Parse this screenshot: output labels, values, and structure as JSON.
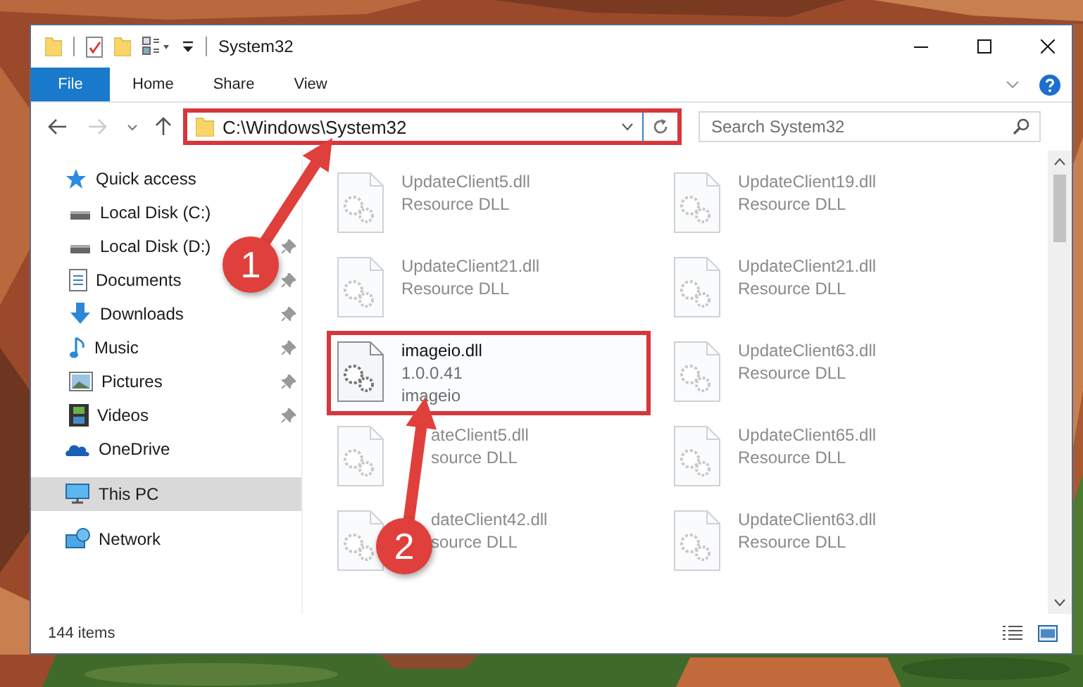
{
  "window": {
    "title": "System32"
  },
  "ribbon": {
    "tabs": [
      {
        "label": "File",
        "kind": "file",
        "selected": false
      },
      {
        "label": "Home",
        "kind": "tab",
        "selected": false
      },
      {
        "label": "Share",
        "kind": "tab",
        "selected": false
      },
      {
        "label": "View",
        "kind": "tab",
        "selected": false
      }
    ]
  },
  "address_bar": {
    "path": "C:\\Windows\\System32",
    "highlighted": true
  },
  "search": {
    "placeholder": "Search System32"
  },
  "nav": {
    "items": [
      {
        "label": "Quick access",
        "kind": "star",
        "selected": false,
        "children": [
          {
            "label": "Local Disk (C:)",
            "kind": "drive",
            "selected": false,
            "pinned": false
          },
          {
            "label": "Local Disk (D:)",
            "kind": "drive",
            "selected": false,
            "pinned": true
          },
          {
            "label": "Documents",
            "kind": "document",
            "selected": false,
            "pinned": true
          },
          {
            "label": "Downloads",
            "kind": "download",
            "selected": false,
            "pinned": true
          },
          {
            "label": "Music",
            "kind": "music",
            "selected": false,
            "pinned": true
          },
          {
            "label": "Pictures",
            "kind": "picture",
            "selected": false,
            "pinned": true
          },
          {
            "label": "Videos",
            "kind": "video",
            "selected": false,
            "pinned": true
          }
        ]
      },
      {
        "label": "OneDrive",
        "kind": "cloud",
        "selected": false
      },
      {
        "label": "This PC",
        "kind": "computer",
        "selected": true
      },
      {
        "label": "Network",
        "kind": "network",
        "selected": false
      }
    ]
  },
  "files": [
    {
      "name": "UpdateClient5.dll",
      "details": [
        "Resource DLL"
      ],
      "faded": true,
      "highlighted": false
    },
    {
      "name": "UpdateClient19.dll",
      "details": [
        "Resource DLL"
      ],
      "faded": true,
      "highlighted": false
    },
    {
      "name": "UpdateClient21.dll",
      "details": [
        "Resource DLL"
      ],
      "faded": true,
      "highlighted": false
    },
    {
      "name": "UpdateClient21.dll",
      "details": [
        "Resource DLL"
      ],
      "faded": true,
      "highlighted": false
    },
    {
      "name": "imageio.dll",
      "details": [
        "1.0.0.41",
        "imageio"
      ],
      "faded": false,
      "highlighted": true
    },
    {
      "name": "UpdateClient63.dll",
      "details": [
        "Resource DLL"
      ],
      "faded": true,
      "highlighted": false
    },
    {
      "name": "ateClient5.dll",
      "details": [
        "source DLL"
      ],
      "faded": true,
      "highlighted": false,
      "partly_covered": true
    },
    {
      "name": "UpdateClient65.dll",
      "details": [
        "Resource DLL"
      ],
      "faded": true,
      "highlighted": false
    },
    {
      "name": "dateClient42.dll",
      "details": [
        "source DLL"
      ],
      "faded": true,
      "highlighted": false,
      "partly_covered": true
    },
    {
      "name": "UpdateClient63.dll",
      "details": [
        "Resource DLL"
      ],
      "faded": true,
      "highlighted": false
    }
  ],
  "status_bar": {
    "item_count": "144 items"
  },
  "callouts": [
    {
      "number": "1"
    },
    {
      "number": "2"
    }
  ]
}
